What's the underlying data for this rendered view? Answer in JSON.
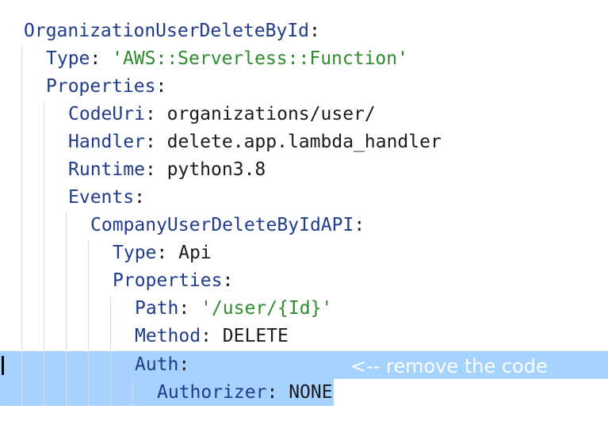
{
  "code_lines": [
    {
      "key": "OrganizationUserDeleteById",
      "sep": ":",
      "value": "",
      "string": ""
    },
    {
      "key": "Type",
      "sep": ": ",
      "value": "",
      "string": "'AWS::Serverless::Function'"
    },
    {
      "key": "Properties",
      "sep": ":",
      "value": "",
      "string": ""
    },
    {
      "key": "CodeUri",
      "sep": ": ",
      "value": "organizations/user/",
      "string": ""
    },
    {
      "key": "Handler",
      "sep": ": ",
      "value": "delete.app.lambda_handler",
      "string": ""
    },
    {
      "key": "Runtime",
      "sep": ": ",
      "value": "python3.8",
      "string": ""
    },
    {
      "key": "Events",
      "sep": ":",
      "value": "",
      "string": ""
    },
    {
      "key": "CompanyUserDeleteByIdAPI",
      "sep": ":",
      "value": "",
      "string": ""
    },
    {
      "key": "Type",
      "sep": ": ",
      "value": "Api",
      "string": ""
    },
    {
      "key": "Properties",
      "sep": ":",
      "value": "",
      "string": ""
    },
    {
      "key": "Path",
      "sep": ": ",
      "value": "",
      "string": "'/user/{Id}'"
    },
    {
      "key": "Method",
      "sep": ": ",
      "value": "DELETE",
      "string": ""
    },
    {
      "key": "Auth",
      "sep": ":",
      "value": "",
      "string": ""
    },
    {
      "key": "Authorizer",
      "sep": ": ",
      "value": "NONE",
      "string": ""
    }
  ],
  "annotation": "<-- remove the code",
  "colors": {
    "key": "#1f3b8c",
    "string": "#2e8b2e",
    "selection": "#a6d2ff",
    "annotation_text": "#ffffff"
  }
}
